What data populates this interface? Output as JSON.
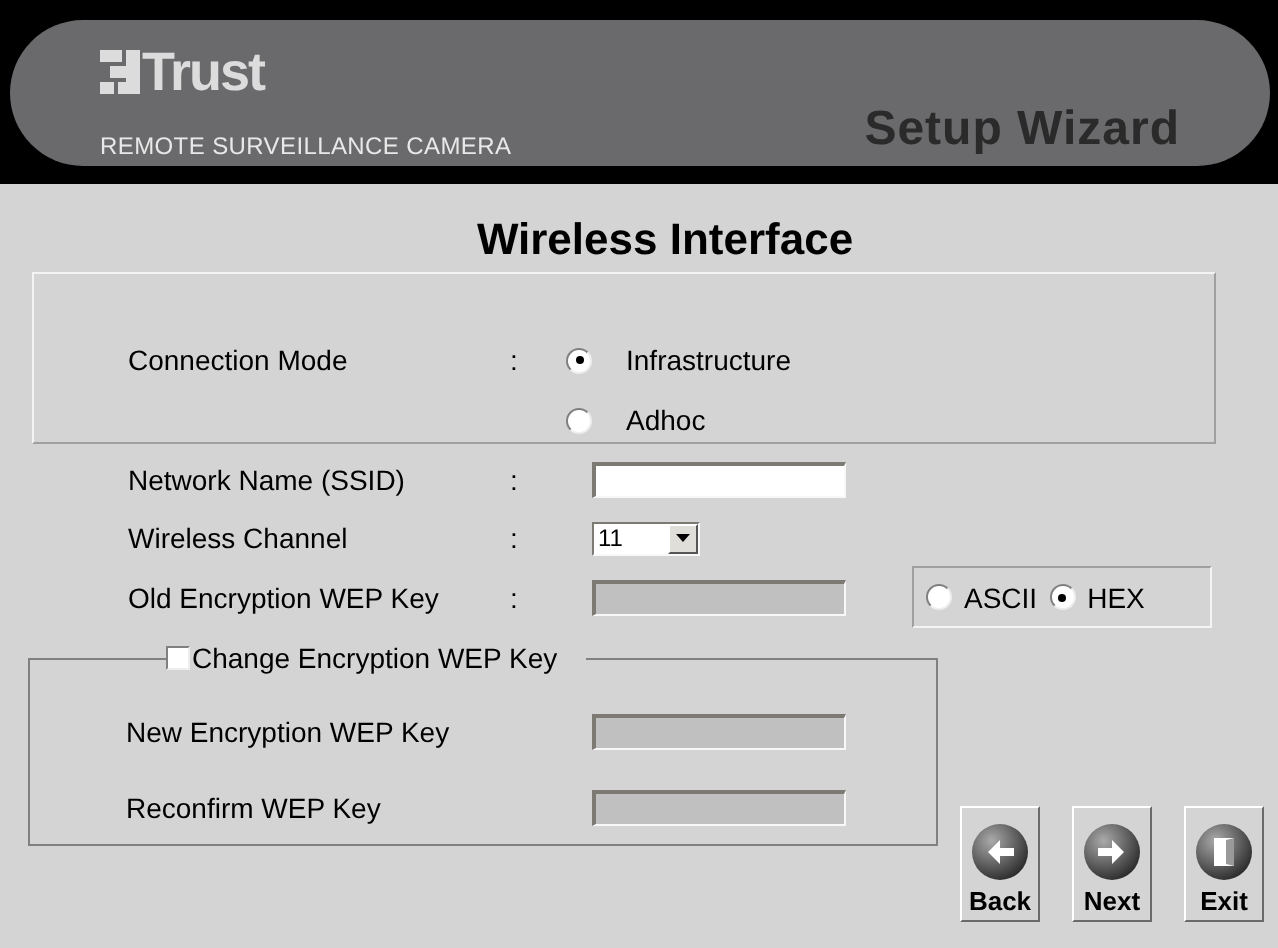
{
  "header": {
    "logo": "Trust",
    "subtitle": "REMOTE SURVEILLANCE CAMERA",
    "title": "Setup Wizard"
  },
  "page_title": "Wireless Interface",
  "connection_mode": {
    "label": "Connection  Mode",
    "colon": ":",
    "options": [
      {
        "label": "Infrastructure",
        "selected": true
      },
      {
        "label": "Adhoc",
        "selected": false
      }
    ]
  },
  "fields": [
    {
      "kind": "text",
      "label": "Network Name (SSID)",
      "colon": ":",
      "disabled": false
    },
    {
      "kind": "select",
      "label": "Wireless Channel",
      "colon": ":",
      "value": "11"
    },
    {
      "kind": "text",
      "label": "Old Encryption WEP Key",
      "colon": ":",
      "disabled": true
    }
  ],
  "key_format": [
    {
      "label": "ASCII",
      "selected": false
    },
    {
      "label": "HEX",
      "selected": true
    }
  ],
  "change_key": {
    "label": "Change Encryption WEP Key",
    "checked": false,
    "fields": [
      {
        "label": "New Encryption WEP Key",
        "disabled": true
      },
      {
        "label": "Reconfirm WEP Key",
        "disabled": true
      }
    ]
  },
  "buttons": [
    {
      "kind": "back",
      "label": "Back"
    },
    {
      "kind": "next",
      "label": "Next"
    },
    {
      "kind": "exit",
      "label": "Exit"
    }
  ]
}
